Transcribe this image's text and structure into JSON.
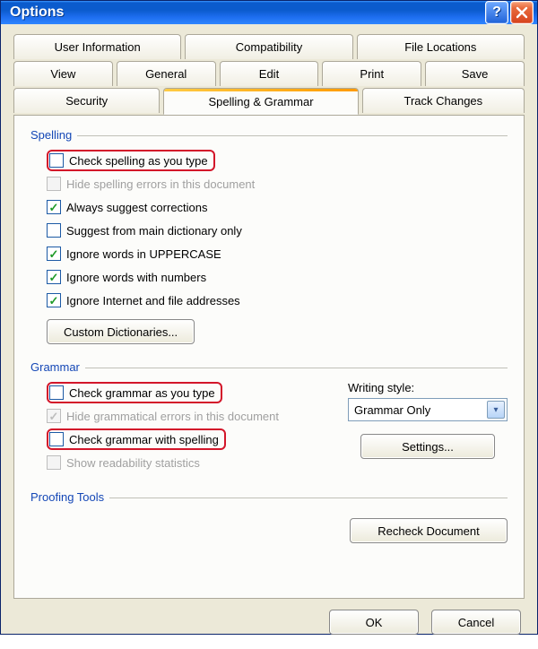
{
  "title": "Options",
  "tabs": {
    "row1": [
      "User Information",
      "Compatibility",
      "File Locations"
    ],
    "row2": [
      "View",
      "General",
      "Edit",
      "Print",
      "Save"
    ],
    "row3": [
      "Security",
      "Spelling & Grammar",
      "Track Changes"
    ]
  },
  "active_tab": "Spelling & Grammar",
  "spelling": {
    "title": "Spelling",
    "opts": {
      "check_as_type": {
        "label": "Check spelling as you type",
        "checked": false,
        "disabled": false,
        "highlight": true
      },
      "hide_errors": {
        "label": "Hide spelling errors in this document",
        "checked": false,
        "disabled": true
      },
      "always_suggest": {
        "label": "Always suggest corrections",
        "checked": true
      },
      "main_dict_only": {
        "label": "Suggest from main dictionary only",
        "checked": false
      },
      "ignore_uppercase": {
        "label": "Ignore words in UPPERCASE",
        "checked": true
      },
      "ignore_numbers": {
        "label": "Ignore words with numbers",
        "checked": true
      },
      "ignore_internet": {
        "label": "Ignore Internet and file addresses",
        "checked": true
      }
    },
    "custom_dict_btn": "Custom Dictionaries..."
  },
  "grammar": {
    "title": "Grammar",
    "opts": {
      "check_as_type": {
        "label": "Check grammar as you type",
        "checked": false,
        "highlight": true
      },
      "hide_errors": {
        "label": "Hide grammatical errors in this document",
        "checked": true,
        "disabled": true
      },
      "with_spelling": {
        "label": "Check grammar with spelling",
        "checked": false,
        "highlight": true
      },
      "readability": {
        "label": "Show readability statistics",
        "checked": false,
        "disabled": true
      }
    },
    "writing_style_label": "Writing style:",
    "writing_style_value": "Grammar Only",
    "settings_btn": "Settings..."
  },
  "proofing": {
    "title": "Proofing Tools",
    "recheck_btn": "Recheck Document"
  },
  "buttons": {
    "ok": "OK",
    "cancel": "Cancel"
  }
}
